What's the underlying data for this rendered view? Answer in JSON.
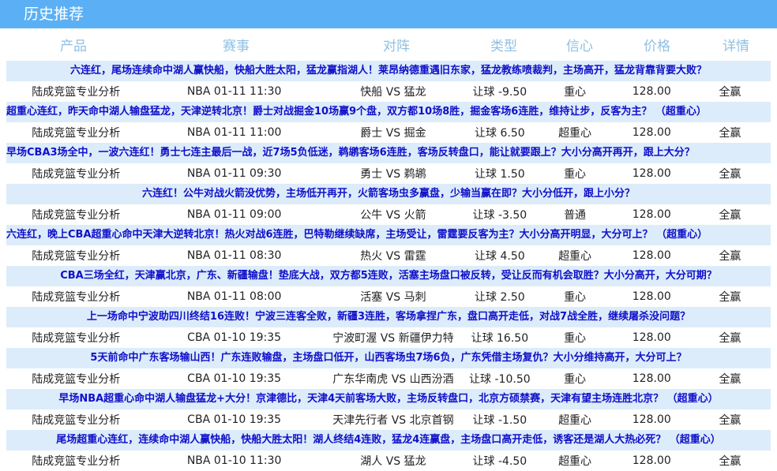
{
  "section_title": "历史推荐",
  "columns": [
    "产品",
    "赛事",
    "对阵",
    "类型",
    "信心",
    "价格",
    "详情"
  ],
  "records": [
    {
      "headline": "六连红，尾场连续命中湖人赢快船，快船大胜太阳，猛龙赢指湖人！莱昂纳德重遇旧东家，猛龙教练喷裁判，主场高开，猛龙背靠背要大败？",
      "align": "center",
      "product": "陆成竞篮专业分析",
      "event": "NBA 01-11 11:30",
      "match": "快船 VS 猛龙",
      "type": "让球 -9.50",
      "confidence": "重心",
      "price": "128.00",
      "detail": "全赢"
    },
    {
      "headline": "超重心连红，昨天命中湖人输盘猛龙，天津逆转北京！爵士对战掘金10场赢9个盘，双方都10场8胜，掘金客场6连胜，维持让步，反客为主？ （超重心）",
      "align": "left",
      "product": "陆成竞篮专业分析",
      "event": "NBA 01-11 11:00",
      "match": "爵士 VS 掘金",
      "type": "让球 6.50",
      "confidence": "超重心",
      "price": "128.00",
      "detail": "全赢"
    },
    {
      "headline": "早场CBA3场全中，一波六连红！勇士七连主最后一战，近7场5负低迷，鹈鹕客场6连胜，客场反转盘口，能让就要跟上？大小分高开再开，跟上大分？",
      "align": "left",
      "product": "陆成竞篮专业分析",
      "event": "NBA 01-11 09:30",
      "match": "勇士 VS 鹈鹕",
      "type": "让球 1.50",
      "confidence": "重心",
      "price": "128.00",
      "detail": "全赢"
    },
    {
      "headline": "六连红！公牛对战火箭没优势，主场低开再开，火箭客场虫多赢盘，少输当赢在即？大小分低开，跟上小分？",
      "align": "center",
      "product": "陆成竞篮专业分析",
      "event": "NBA 01-11 09:00",
      "match": "公牛 VS 火箭",
      "type": "让球 -3.50",
      "confidence": "普通",
      "price": "128.00",
      "detail": "全赢"
    },
    {
      "headline": "六连红，晚上CBA超重心命中天津大逆转北京！热火对战6连胜，巴特勒继续缺席，主场受让，雷霆要反客为主？大小分高开明显，大分可上？ （超重心）",
      "align": "left",
      "product": "陆成竞篮专业分析",
      "event": "NBA 01-11 08:30",
      "match": "热火 VS 雷霆",
      "type": "让球 4.50",
      "confidence": "超重心",
      "price": "128.00",
      "detail": "全赢"
    },
    {
      "headline": "CBA三场全红，天津赢北京，广东、新疆输盘！垫底大战，双方都5连败，活塞主场盘口被反转，受让反而有机会取胜？大小分高开，大分可期？",
      "align": "center",
      "product": "陆成竞篮专业分析",
      "event": "NBA 01-11 08:00",
      "match": "活塞 VS 马刺",
      "type": "让球 2.50",
      "confidence": "重心",
      "price": "128.00",
      "detail": "全赢"
    },
    {
      "headline": "上一场命中宁波助四川终结16连败！宁波三连客全败，新疆3连胜，客场拿捏广东，盘口高开走低，对战7战全胜，继续屠杀没问题？",
      "align": "center",
      "product": "陆成竞篮专业分析",
      "event": "CBA 01-10 19:35",
      "match": "宁波町渥 VS 新疆伊力特",
      "type": "让球 16.50",
      "confidence": "重心",
      "price": "128.00",
      "detail": "全赢"
    },
    {
      "headline": "5天前命中广东客场输山西！广东连败输盘，主场盘口低开，山西客场虫7场6负，广东凭借主场复仇？大小分维持高开，大分可上？",
      "align": "center",
      "product": "陆成竞篮专业分析",
      "event": "CBA 01-10 19:35",
      "match": "广东华南虎 VS 山西汾酒",
      "type": "让球 -10.50",
      "confidence": "重心",
      "price": "128.00",
      "detail": "全赢"
    },
    {
      "headline": "早场NBA超重心命中湖人输盘猛龙+大分！京津德比，天津4天前客场大败，主场反转盘口，北京方硕禁赛，天津有望主场连胜北京？ （超重心）",
      "align": "center",
      "product": "陆成竞篮专业分析",
      "event": "CBA 01-10 19:35",
      "match": "天津先行者 VS 北京首钢",
      "type": "让球 -1.50",
      "confidence": "超重心",
      "price": "128.00",
      "detail": "全赢"
    },
    {
      "headline": "尾场超重心连红，连续命中湖人赢快船，快船大胜太阳！湖人终结4连败，猛龙4连赢盘，主场盘口高开走低，诱客还是湖人大热必死？ （超重心）",
      "align": "center",
      "product": "陆成竞篮专业分析",
      "event": "NBA 01-10 11:30",
      "match": "湖人 VS 猛龙",
      "type": "让球 -4.50",
      "confidence": "超重心",
      "price": "128.00",
      "detail": "全赢"
    }
  ]
}
